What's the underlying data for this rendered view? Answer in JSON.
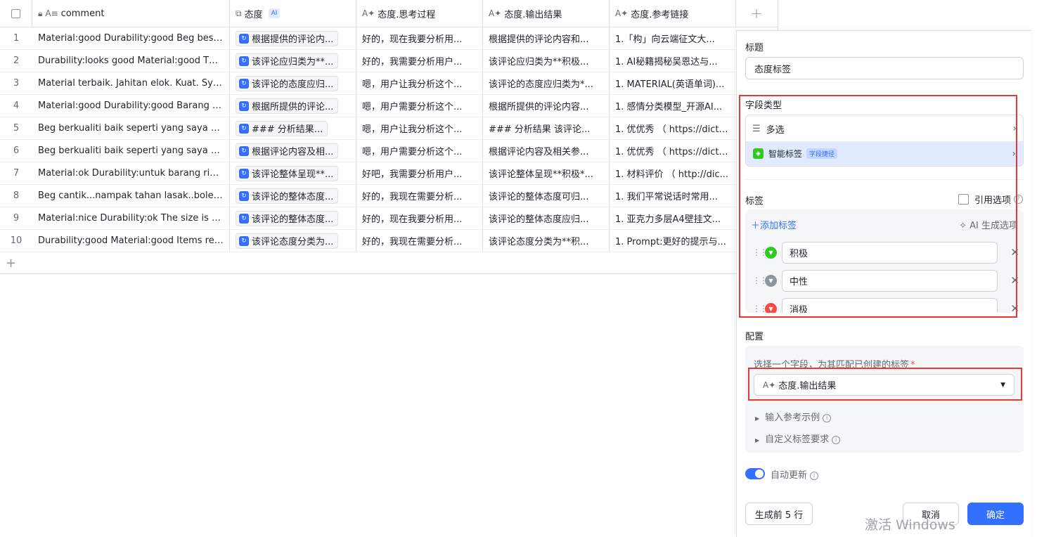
{
  "grid": {
    "columns": [
      {
        "label": "comment",
        "icon": "A≡"
      },
      {
        "label": "态度",
        "icon": "⧉",
        "badge": "AI"
      },
      {
        "label": "态度.思考过程",
        "icon": "A✦"
      },
      {
        "label": "态度.输出结果",
        "icon": "A✦"
      },
      {
        "label": "态度.参考链接",
        "icon": "A✦"
      }
    ],
    "rows": [
      {
        "n": "1",
        "comment": "Material:good Durability:good Beg besar...",
        "attitude": "根据提供的评论内...",
        "think": "好的，现在我要分析用...",
        "output": "根据提供的评论内容和...",
        "link": "1.「构」向云端征文大..."
      },
      {
        "n": "2",
        "comment": "Durability:looks good Material:good The ...",
        "attitude": "该评论应归类为**...",
        "think": "好的，我需要分析用户...",
        "output": "该评论应归类为**积极...",
        "link": "1. AI秘籍揭秘吴恩达与..."
      },
      {
        "n": "3",
        "comment": "Material terbaik. Jahitan elok. Kuat. Sy ...",
        "attitude": "该评论的态度应归...",
        "think": "嗯，用户让我分析这个...",
        "output": "该评论的态度应归类为*...",
        "link": "1. MATERIAL(英语单词)..."
      },
      {
        "n": "4",
        "comment": "Material:good Durability:good Barang se...",
        "attitude": "根据所提供的评论...",
        "think": "嗯，用户需要分析这个...",
        "output": "根据所提供的评论内容...",
        "link": "1. 感情分类模型_开源AI..."
      },
      {
        "n": "5",
        "comment": "Beg berkualiti baik seperti yang saya na...",
        "attitude": "### 分析结果...",
        "think": "嗯，用户让我分析这个...",
        "output": "### 分析结果 该评论...",
        "link": "1. 优优秀 （ https://dict...."
      },
      {
        "n": "6",
        "comment": "Beg berkualiti baik seperti yang saya na...",
        "attitude": "根据评论内容及相...",
        "think": "嗯，用户需要分析这个...",
        "output": "根据评论内容及相关参...",
        "link": "1. 优优秀 （ https://dict...."
      },
      {
        "n": "7",
        "comment": "Material:ok Durability:untuk barang ring...",
        "attitude": "该评论整体呈现**...",
        "think": "好吧，我需要分析用户...",
        "output": "该评论整体呈现**积极*...",
        "link": "1. 材料评价 （ http://dic..."
      },
      {
        "n": "8",
        "comment": "Beg cantik...nampak tahan lasak..boleh l...",
        "attitude": "该评论的整体态度...",
        "think": "好的，我现在需要分析...",
        "output": "该评论的整体态度可归...",
        "link": "1. 我们平常说话时常用..."
      },
      {
        "n": "9",
        "comment": "Material:nice Durability:ok The size is ac...",
        "attitude": "该评论的整体态度...",
        "think": "好的，现在我要分析用...",
        "output": "该评论的整体态度应归...",
        "link": "1. 亚克力多层A4壁挂文..."
      },
      {
        "n": "10",
        "comment": "Durability:good Material:good Items rec...",
        "attitude": "该评论态度分类为...",
        "think": "好的，我现在需要分析...",
        "output": "该评论态度分类为**积...",
        "link": "1. Prompt:更好的提示与..."
      }
    ],
    "add_col": "+",
    "add_row": "+"
  },
  "panel": {
    "title_label": "标题",
    "title_value": "态度标签",
    "field_type_label": "字段类型",
    "types": [
      {
        "label": "多选"
      },
      {
        "label": "智能标签",
        "badge": "字段捷径"
      }
    ],
    "tags_label": "标签",
    "ref_option_label": "引用选项",
    "add_tag": "添加标签",
    "ai_generate": "AI 生成选项",
    "tags": [
      {
        "label": "积极",
        "color": "#34c724"
      },
      {
        "label": "中性",
        "color": "#8f959e"
      },
      {
        "label": "消极",
        "color": "#f54a45"
      }
    ],
    "config_label": "配置",
    "select_field_label": "选择一个字段，为其匹配已创建的标签",
    "required_mark": "*",
    "selected_field": "态度.输出结果",
    "example_label": "输入参考示例",
    "custom_req_label": "自定义标签要求",
    "auto_update_label": "自动更新",
    "auto_update_on": true,
    "generate_first": "生成前 5 行",
    "cancel": "取消",
    "confirm": "确定"
  },
  "watermark": "激活 Windows",
  "colors": {
    "accent": "#3370ff",
    "highlight": "#e53935"
  }
}
